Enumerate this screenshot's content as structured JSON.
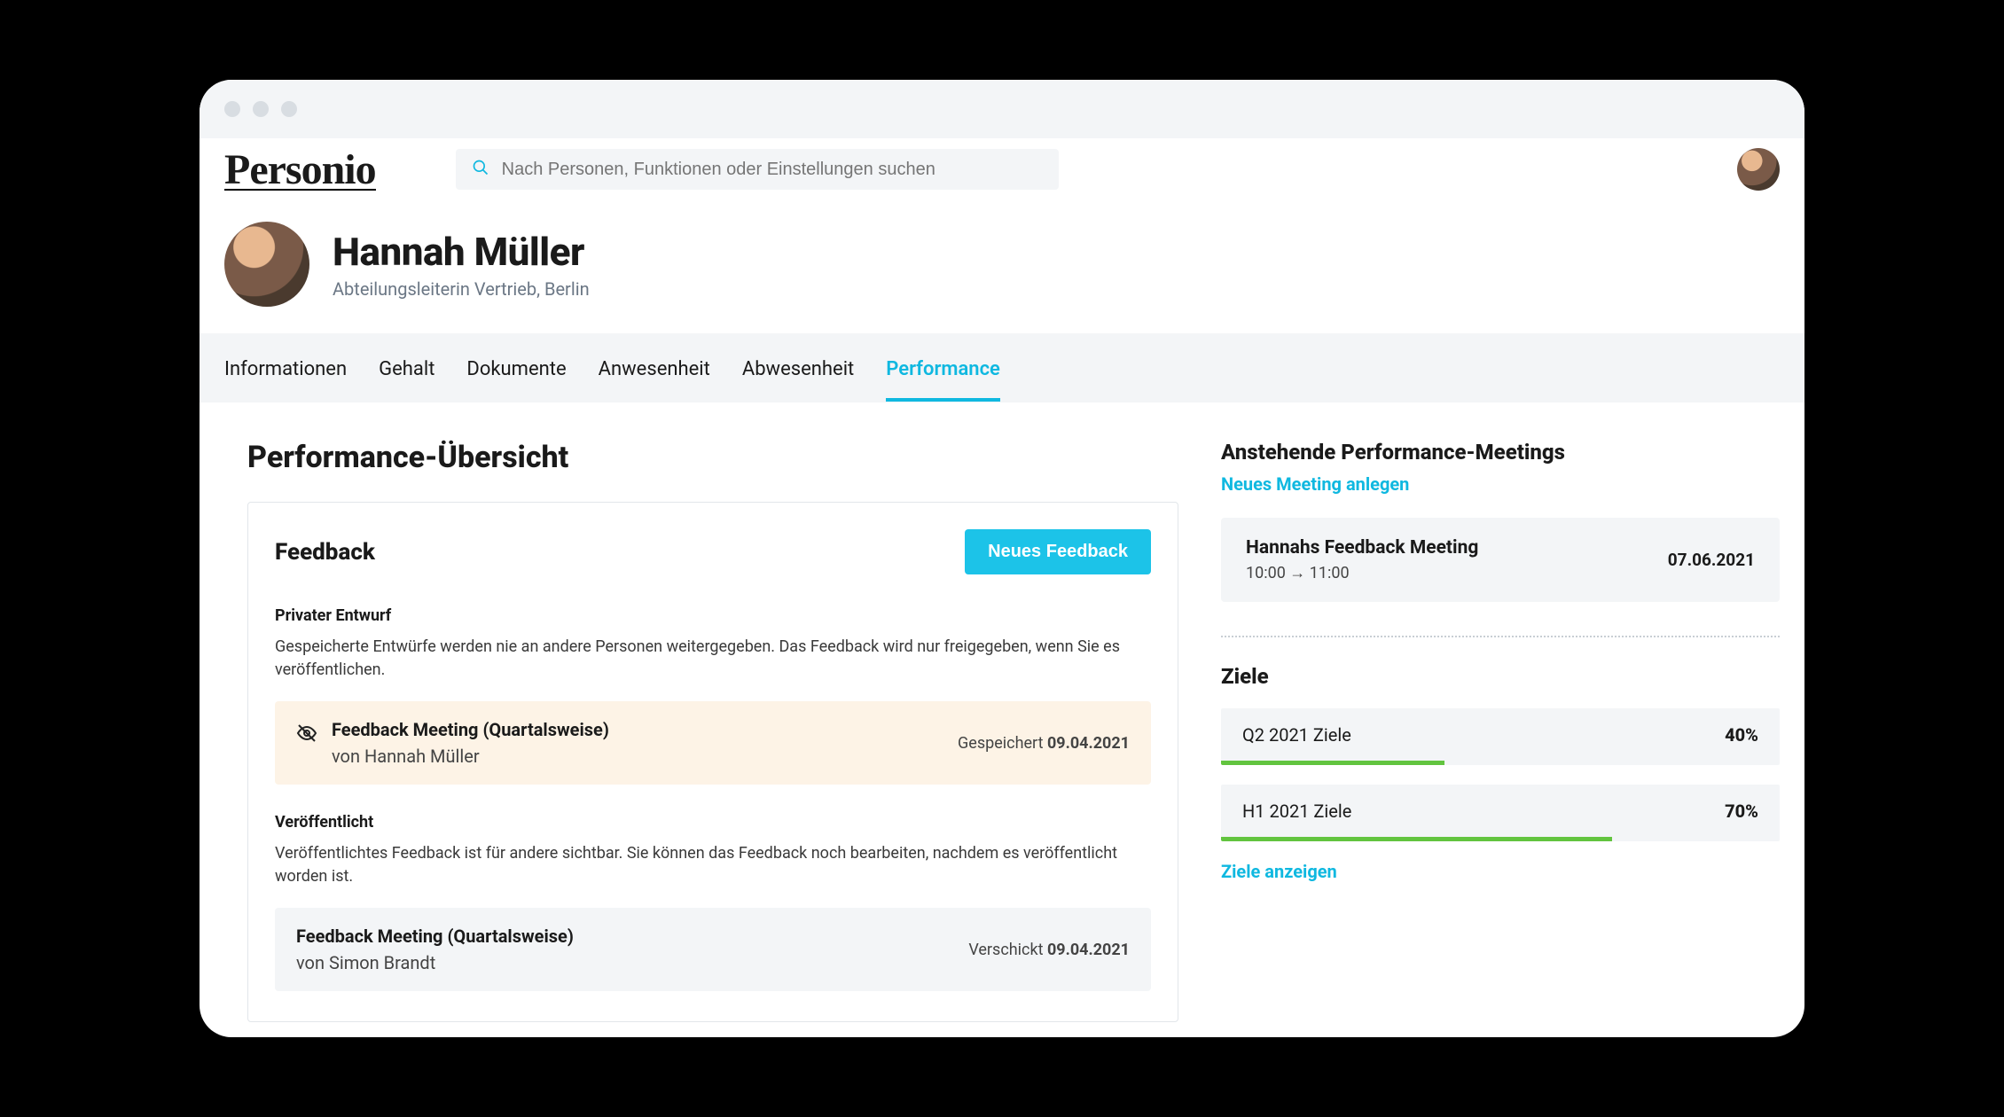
{
  "brand": "Personio",
  "search": {
    "placeholder": "Nach Personen, Funktionen oder Einstellungen suchen"
  },
  "profile": {
    "name": "Hannah Müller",
    "subtitle": "Abteilungsleiterin Vertrieb, Berlin"
  },
  "tabs": [
    {
      "label": "Informationen",
      "active": false
    },
    {
      "label": "Gehalt",
      "active": false
    },
    {
      "label": "Dokumente",
      "active": false
    },
    {
      "label": "Anwesenheit",
      "active": false
    },
    {
      "label": "Abwesenheit",
      "active": false
    },
    {
      "label": "Performance",
      "active": true
    }
  ],
  "page_title": "Performance-Übersicht",
  "feedback": {
    "title": "Feedback",
    "new_button": "Neues Feedback",
    "draft_section": {
      "title": "Privater Entwurf",
      "desc": "Gespeicherte Entwürfe werden nie an andere Personen weitergegeben. Das Feedback wird nur freigegeben, wenn Sie es veröffentlichen."
    },
    "draft_item": {
      "title": "Feedback Meeting (Quartalsweise)",
      "by_prefix": "von ",
      "by": "Hannah Müller",
      "status": "Gespeichert",
      "date": "09.04.2021"
    },
    "pub_section": {
      "title": "Veröffentlicht",
      "desc": "Veröffentlichtes Feedback ist für andere sichtbar. Sie können das Feedback noch bearbeiten, nachdem es veröffentlicht worden ist."
    },
    "pub_item": {
      "title": "Feedback Meeting (Quartalsweise)",
      "by_prefix": "von ",
      "by": "Simon Brandt",
      "status": "Verschickt",
      "date": "09.04.2021"
    }
  },
  "meetings": {
    "title": "Anstehende Performance-Meetings",
    "new_link": "Neues Meeting anlegen",
    "item": {
      "title": "Hannahs Feedback Meeting",
      "time": "10:00 → 11:00",
      "date": "07.06.2021"
    }
  },
  "goals": {
    "title": "Ziele",
    "items": [
      {
        "name": "Q2 2021 Ziele",
        "pct": "40%",
        "width": "40%"
      },
      {
        "name": "H1 2021 Ziele",
        "pct": "70%",
        "width": "70%"
      }
    ],
    "show_link": "Ziele anzeigen"
  }
}
